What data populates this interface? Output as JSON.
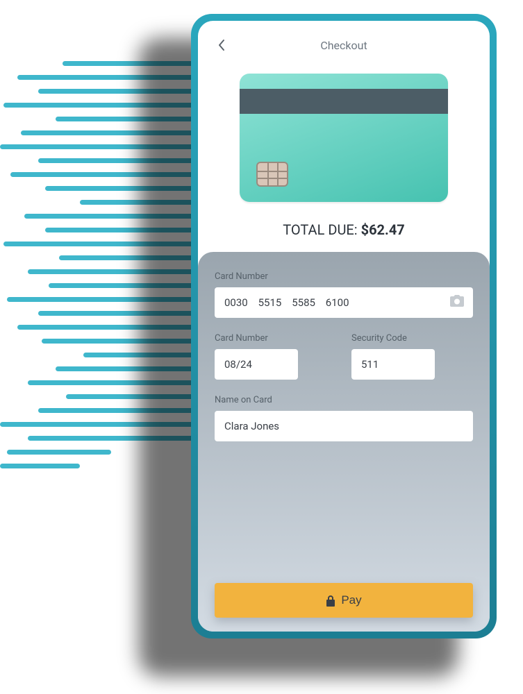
{
  "header": {
    "title": "Checkout"
  },
  "total": {
    "label": "TOTAL DUE: ",
    "amount": "$62.47"
  },
  "form": {
    "card_number_label": "Card Number",
    "card_number_value": "0030    5515    5585    6100",
    "expiry_label": "Card Number",
    "expiry_value": "08/24",
    "cvv_label": "Security Code",
    "cvv_value": "511",
    "name_label": "Name on Card",
    "name_value": "Clara Jones"
  },
  "pay_button_label": "Pay",
  "colors": {
    "accent": "#3fb7cc",
    "pay": "#f2b33e"
  }
}
